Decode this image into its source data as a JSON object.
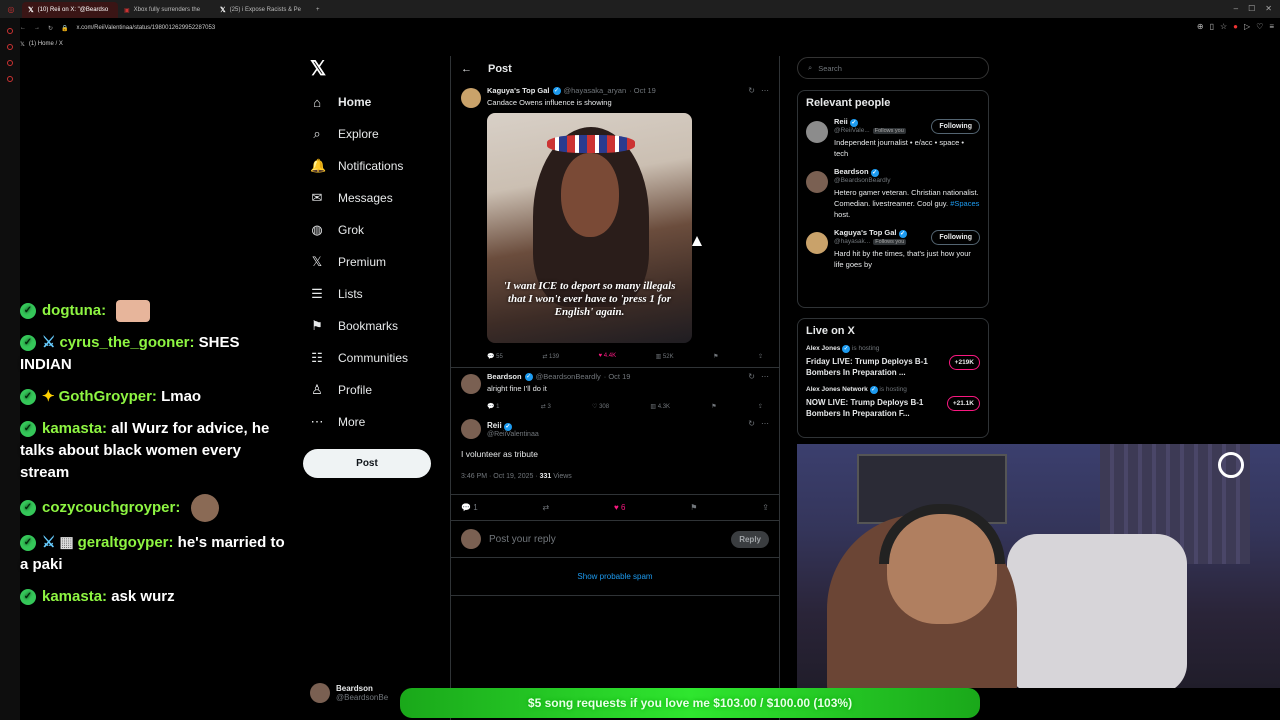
{
  "browser": {
    "tabs": [
      {
        "label": "(10) Reii on X: \"@Beardso",
        "active": true
      },
      {
        "label": "Xbox fully surrenders the",
        "active": false
      },
      {
        "label": "(25) i Expose Racists & Pe",
        "active": false
      }
    ],
    "url": "x.com/ReiiValentinaa/status/1980012629952287053",
    "bookmark": "(1) Home / X"
  },
  "chat": [
    {
      "user": "dogtuna:",
      "text": "",
      "badges": [
        "check"
      ],
      "emote": "smile"
    },
    {
      "user": "cyrus_the_gooner:",
      "text": "SHES INDIAN",
      "badges": [
        "check",
        "sword"
      ]
    },
    {
      "user": "GothGroyper:",
      "text": "Lmao",
      "badges": [
        "check",
        "star"
      ]
    },
    {
      "user": "kamasta:",
      "text": "all Wurz for advice, he talks about black women every stream",
      "badges": [
        "check"
      ]
    },
    {
      "user": "cozycouchgroyper:",
      "text": "",
      "badges": [
        "check"
      ],
      "emote": "face"
    },
    {
      "user": "geraltgoyper:",
      "text": "he's married to a paki",
      "badges": [
        "check",
        "sword",
        "gift"
      ]
    },
    {
      "user": "kamasta:",
      "text": "ask wurz",
      "badges": [
        "check"
      ]
    }
  ],
  "nav": {
    "items": [
      {
        "label": "Home",
        "icon": "home-icon",
        "glyph": "⌂",
        "active": true
      },
      {
        "label": "Explore",
        "icon": "search-icon",
        "glyph": "⌕"
      },
      {
        "label": "Notifications",
        "icon": "bell-icon",
        "glyph": "🔔"
      },
      {
        "label": "Messages",
        "icon": "mail-icon",
        "glyph": "✉"
      },
      {
        "label": "Grok",
        "icon": "grok-icon",
        "glyph": "◍"
      },
      {
        "label": "Premium",
        "icon": "x-icon",
        "glyph": "𝕏"
      },
      {
        "label": "Lists",
        "icon": "list-icon",
        "glyph": "☰"
      },
      {
        "label": "Bookmarks",
        "icon": "bookmark-icon",
        "glyph": "⚑"
      },
      {
        "label": "Communities",
        "icon": "people-icon",
        "glyph": "☷"
      },
      {
        "label": "Profile",
        "icon": "person-icon",
        "glyph": "♙"
      },
      {
        "label": "More",
        "icon": "more-icon",
        "glyph": "⋯"
      }
    ],
    "post_label": "Post",
    "account": {
      "name": "Beardson",
      "handle": "@BeardsonBe"
    }
  },
  "main": {
    "header": "Post",
    "quoted": {
      "name": "Kaguya's Top Gal",
      "handle": "@hayasaka_aryan",
      "date": "· Oct 19",
      "text": "Candace Owens influence is showing",
      "image_caption": "'I want ICE to deport so many illegals that I won't ever have to 'press 1 for English' again.",
      "replies": "55",
      "reposts": "139",
      "likes": "4.4K",
      "views": "52K"
    },
    "reply1": {
      "name": "Beardson",
      "handle": "@BeardsonBeardly",
      "date": "· Oct 19",
      "text": "alright fine I'll do it",
      "replies": "1",
      "reposts": "3",
      "likes": "308",
      "views": "4.3K"
    },
    "focus": {
      "name": "Reii",
      "handle": "@ReiiValentinaa",
      "text": "I volunteer as tribute",
      "time": "3:46 PM · Oct 19, 2025 ·",
      "views_count": "331",
      "views_label": "Views",
      "replies": "1",
      "likes": "6"
    },
    "reply_placeholder": "Post your reply",
    "reply_button": "Reply",
    "spam_link": "Show probable spam"
  },
  "right": {
    "search_placeholder": "Search",
    "relevant_title": "Relevant people",
    "people": [
      {
        "name": "Reii",
        "handle": "@ReiiVale...",
        "follows_you": "Follows you",
        "button": "Following",
        "bio": "Independent journalist • e/acc • space • tech"
      },
      {
        "name": "Beardson",
        "handle": "@BeardsonBeardly",
        "bio": "Hetero gamer veteran. Christian nationalist. Comedian. livestreamer. Cool guy.",
        "tag": "#Spaces",
        "bio_end": "host."
      },
      {
        "name": "Kaguya's Top Gal",
        "handle": "@hayasak...",
        "follows_you": "Follows you",
        "button": "Following",
        "bio": "Hard hit by the times, that's just how your life goes by"
      }
    ],
    "live_title": "Live on X",
    "live": [
      {
        "host": "Alex Jones",
        "status": "is hosting",
        "title": "Friday LIVE: Trump Deploys B-1 Bombers In Preparation ...",
        "count": "+219K"
      },
      {
        "host": "Alex Jones Network",
        "status": "is hosting",
        "title": "NOW LIVE: Trump Deploys B-1 Bombers In Preparation F...",
        "count": "+21.1K"
      }
    ]
  },
  "banner": "$5 song requests if you love me $103.00 / $100.00 (103%)",
  "colors": {
    "accent": "#1d9bf0",
    "like": "#f91880",
    "banner": "#2fe62f"
  }
}
